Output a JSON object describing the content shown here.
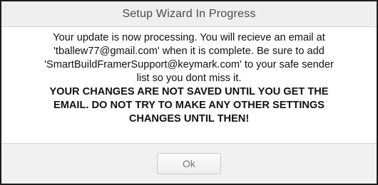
{
  "dialog": {
    "title": "Setup Wizard In Progress",
    "message_lines": [
      "Your update is now processing. You will recieve an email at",
      "'tballew77@gmail.com' when it is complete. Be sure to add",
      "'SmartBuildFramerSupport@keymark.com' to your safe sender",
      "list so you dont miss it."
    ],
    "warning_lines": [
      "YOUR CHANGES ARE NOT SAVED UNTIL YOU GET THE",
      "EMAIL. DO NOT TRY TO MAKE ANY OTHER SETTINGS",
      "CHANGES UNTIL THEN!"
    ],
    "ok_label": "Ok"
  },
  "colors": {
    "header_bg": "#efefef",
    "footer_bg": "#f1f1f1",
    "border": "#1c1c1c",
    "text": "#111111"
  }
}
